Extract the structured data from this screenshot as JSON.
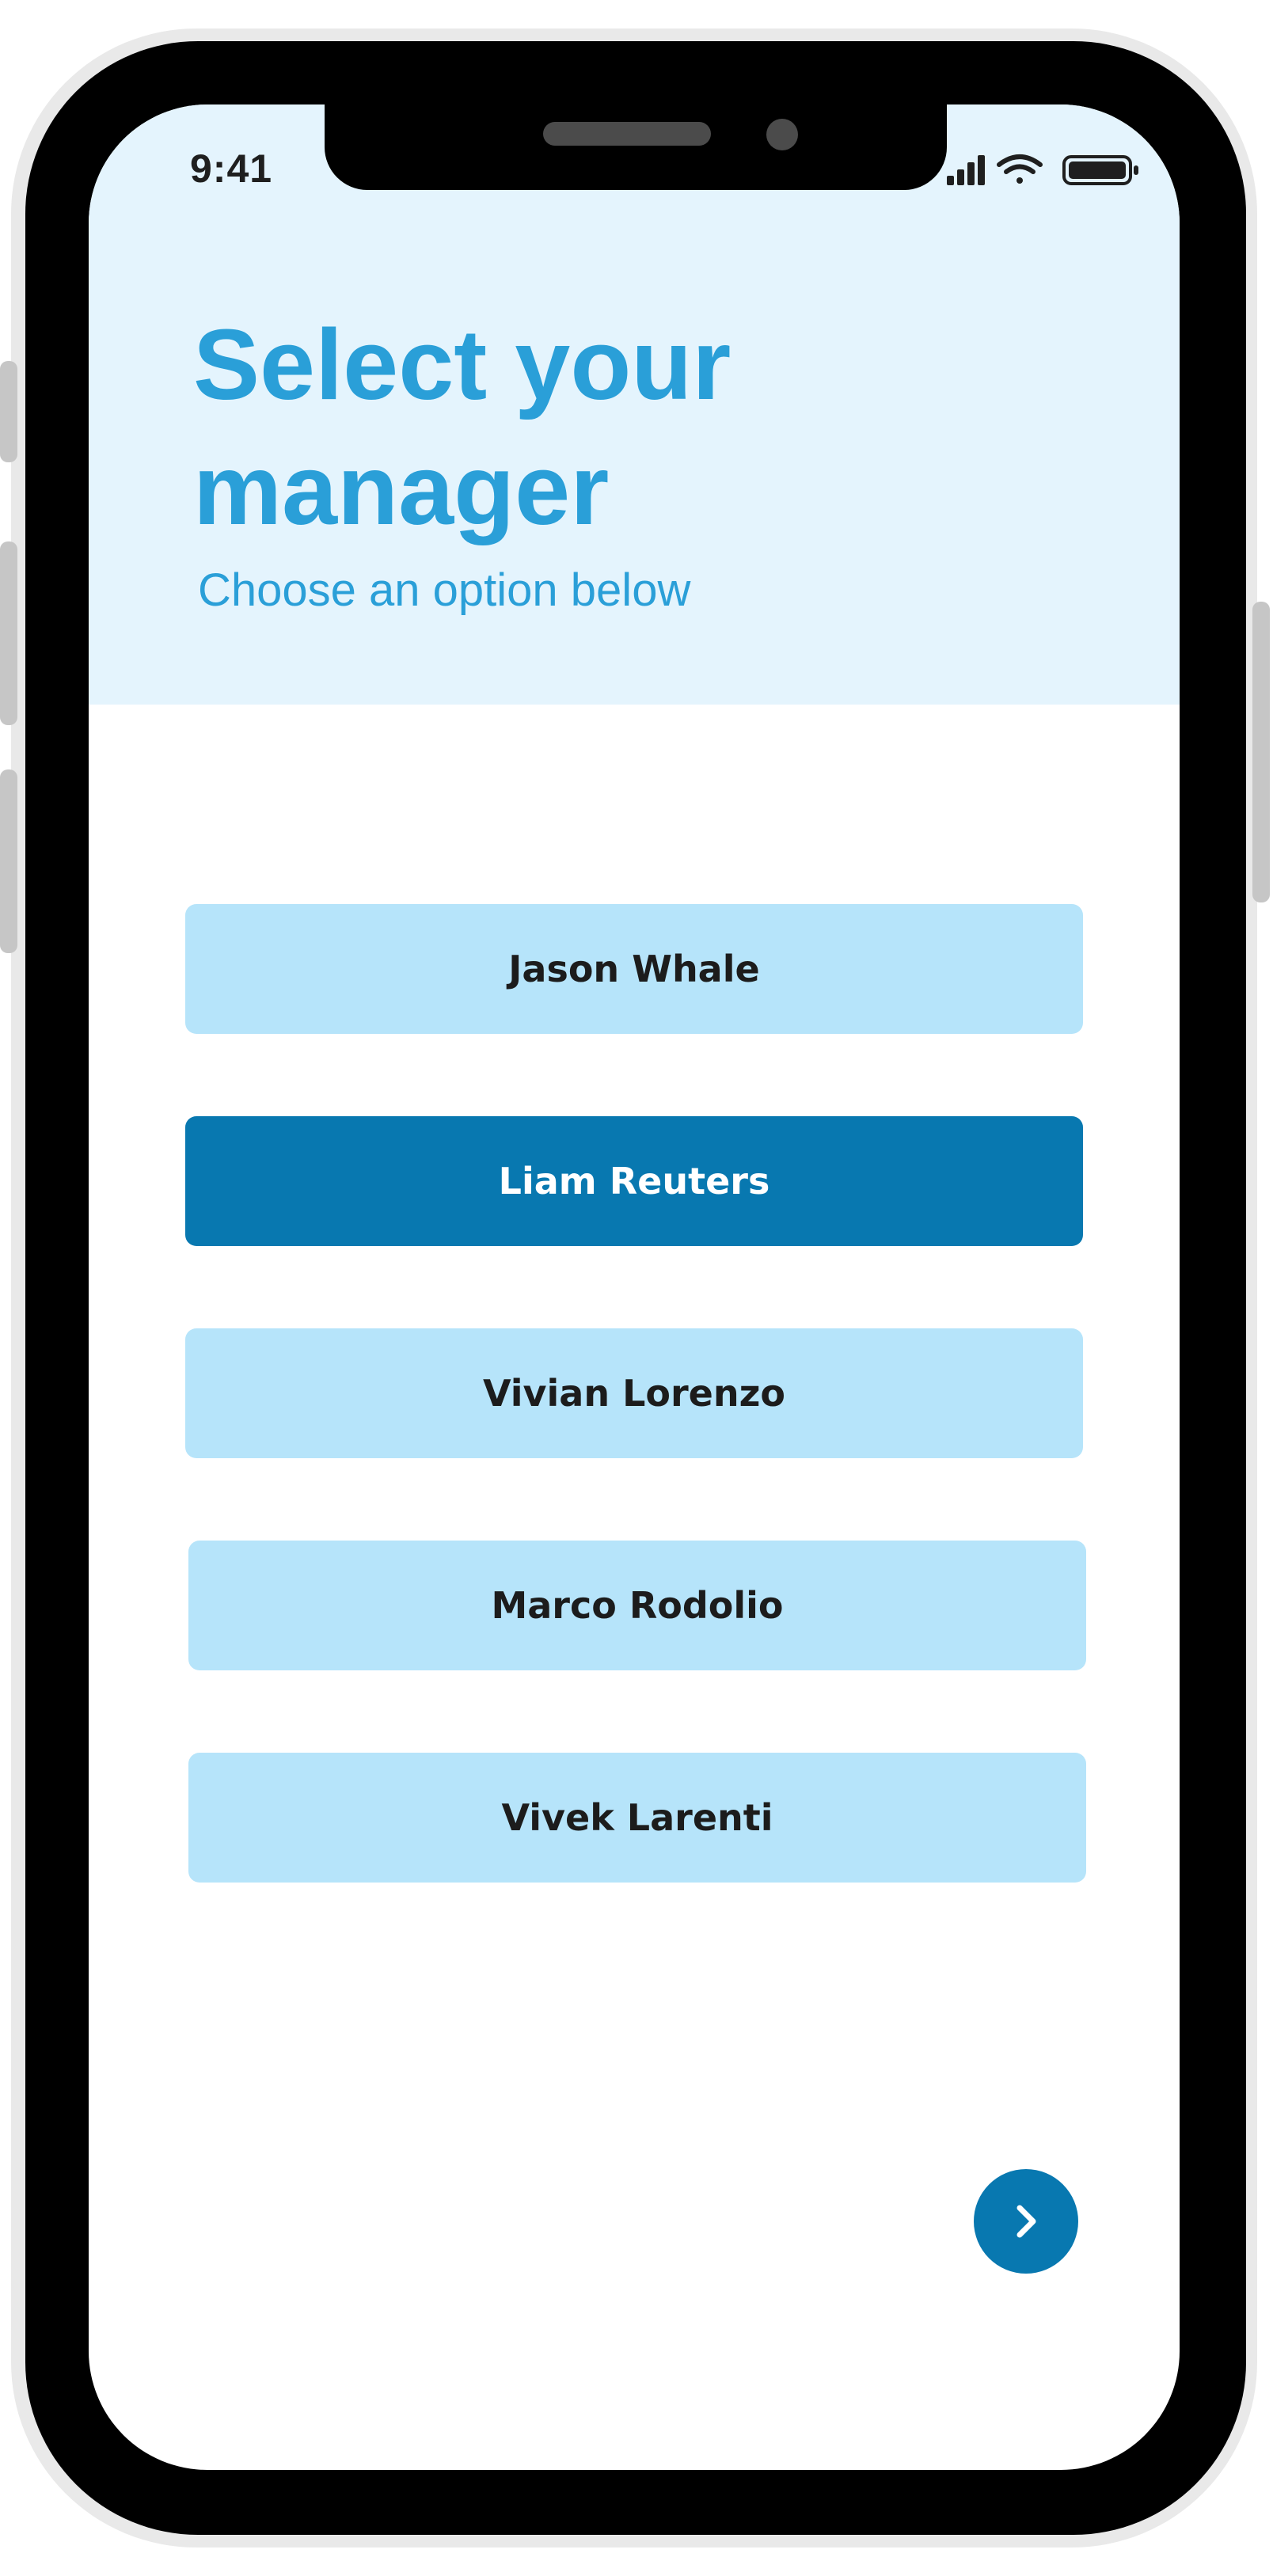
{
  "status_bar": {
    "time": "9:41",
    "icons": [
      "signal-icon",
      "wifi-icon",
      "battery-icon"
    ]
  },
  "header": {
    "title": "Select your manager",
    "subtitle": "Choose an option below"
  },
  "options": [
    {
      "label": "Jason Whale",
      "selected": false
    },
    {
      "label": "Liam Reuters",
      "selected": true
    },
    {
      "label": "Vivian Lorenzo",
      "selected": false
    },
    {
      "label": "Marco Rodolio",
      "selected": false
    },
    {
      "label": "Vivek Larenti",
      "selected": false
    }
  ],
  "next_button": {
    "icon": "chevron-right-icon"
  },
  "colors": {
    "accent": "#2a9fd8",
    "header_bg": "#e4f4fd",
    "option_bg": "#b6e4fa",
    "selected_bg": "#0878b0",
    "bezel": "#000000"
  }
}
